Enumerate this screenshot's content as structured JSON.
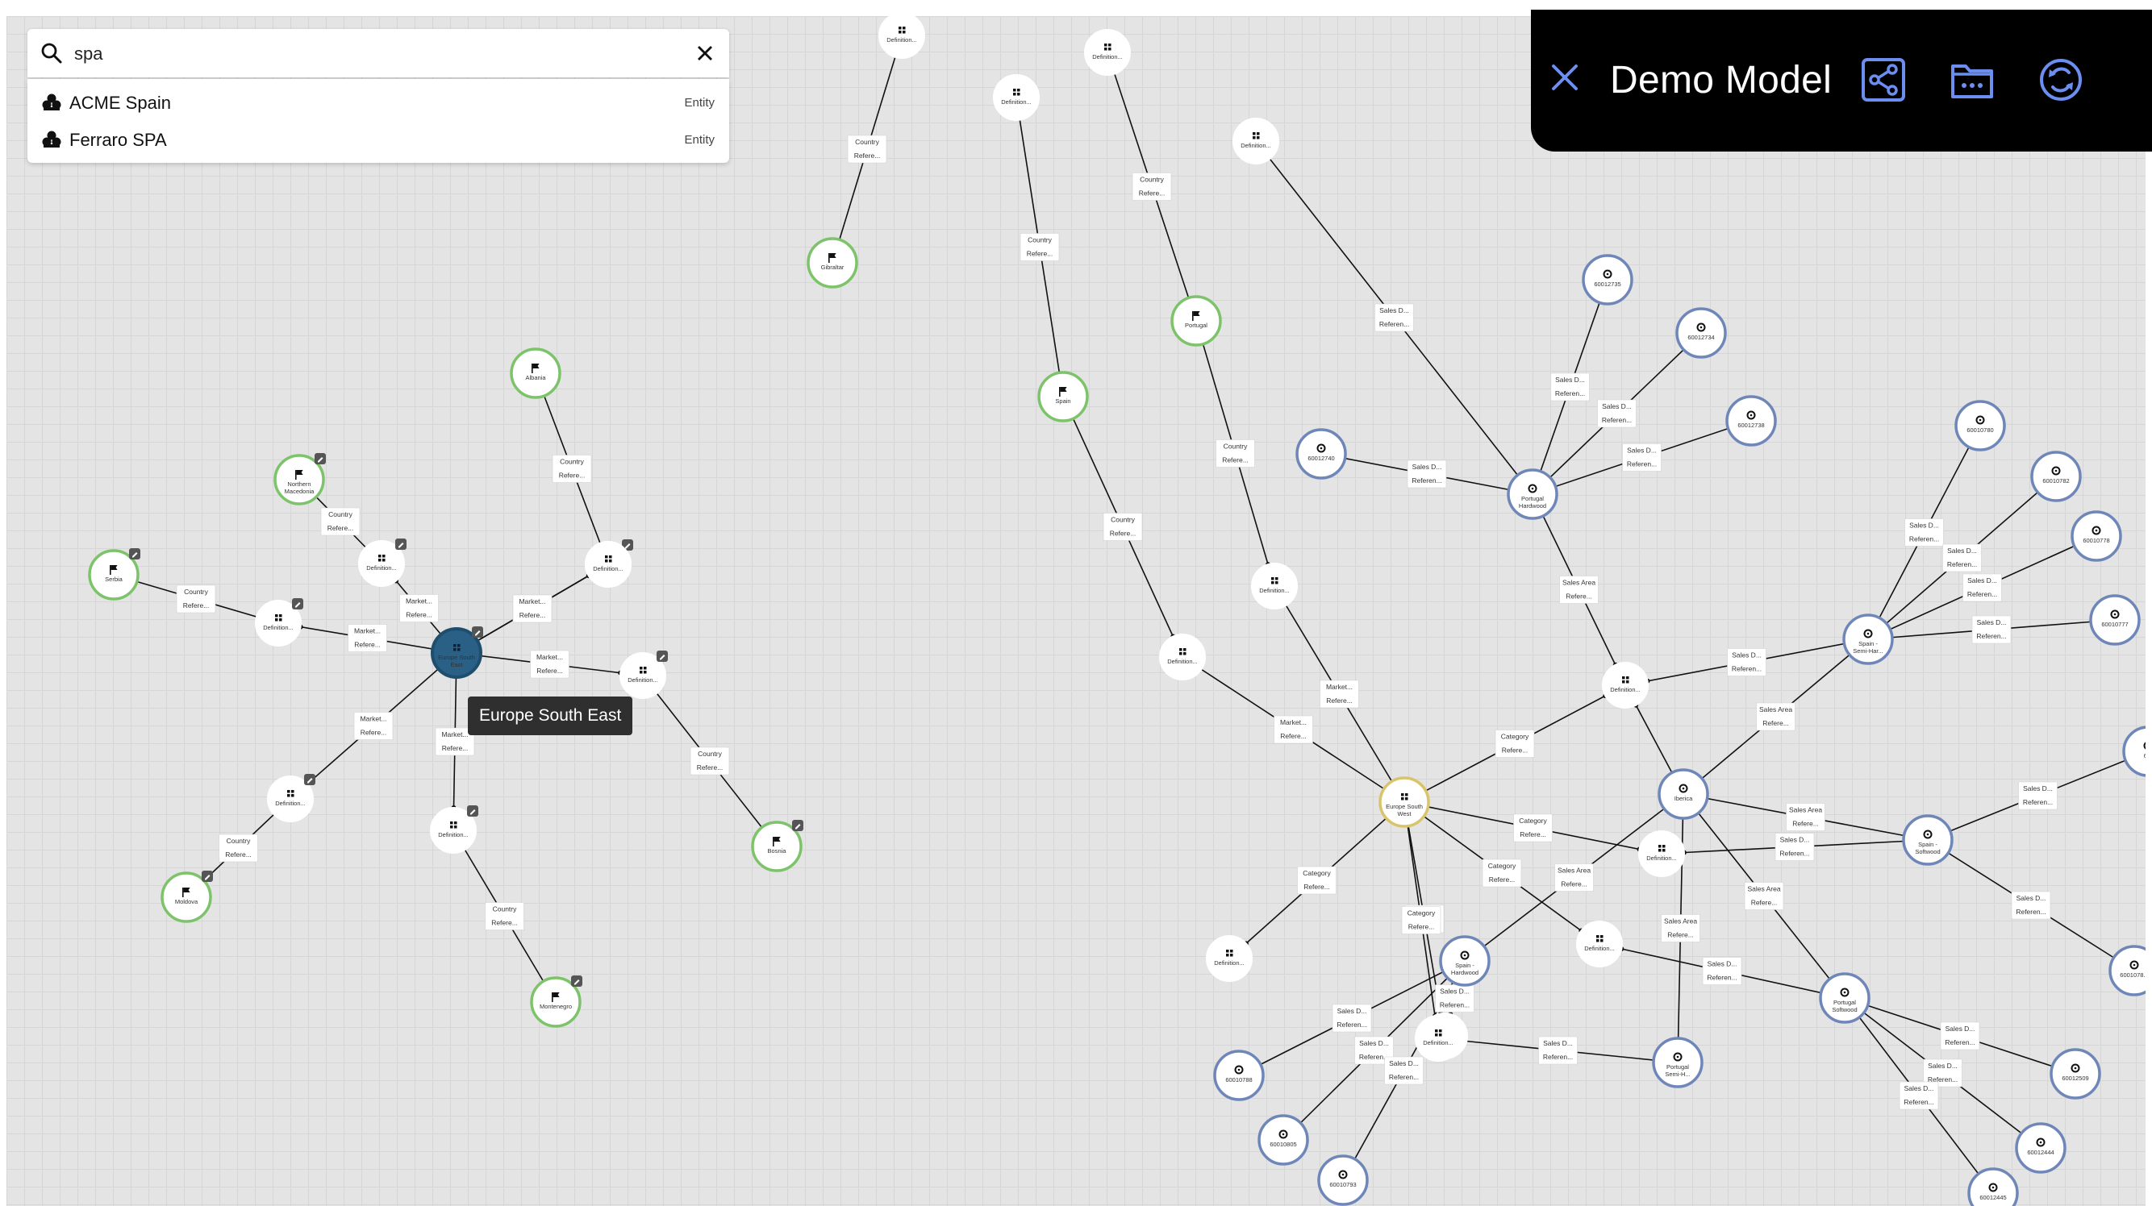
{
  "search": {
    "query": "spa",
    "results": [
      {
        "name": "ACME Spain",
        "type": "Entity"
      },
      {
        "name": "Ferraro SPA",
        "type": "Entity"
      }
    ]
  },
  "header": {
    "title": "Demo Model",
    "buttons": [
      "close-icon",
      "graph-share-icon",
      "folder-icon",
      "sync-icon"
    ]
  },
  "tooltip": "Europe South East",
  "colors": {
    "canvas": "#e4e4e4",
    "country_ring": "#7cc36a",
    "salesarea_ring": "#6f87b8",
    "selected_fill": "#2a5f86",
    "region_ring": "#d8c46a",
    "header_bg": "#000000",
    "header_icon": "#6b8ef0"
  },
  "graph": {
    "nodes": [
      {
        "id": "ese",
        "label": "Europe South East",
        "kind": "selected"
      },
      {
        "id": "esw",
        "label": "Europe South West",
        "kind": "region"
      },
      {
        "id": "albania",
        "label": "Albania",
        "kind": "country"
      },
      {
        "id": "nmac",
        "label": "Northern Macedonia",
        "kind": "country"
      },
      {
        "id": "serbia",
        "label": "Serbia",
        "kind": "country"
      },
      {
        "id": "moldova",
        "label": "Moldova",
        "kind": "country"
      },
      {
        "id": "montenegro",
        "label": "Montenegro",
        "kind": "country"
      },
      {
        "id": "bosnia",
        "label": "Bosnia",
        "kind": "country"
      },
      {
        "id": "gibraltar",
        "label": "Gibraltar",
        "kind": "country"
      },
      {
        "id": "spain",
        "label": "Spain",
        "kind": "country"
      },
      {
        "id": "portugal",
        "label": "Portugal",
        "kind": "country"
      },
      {
        "id": "d1",
        "label": "Definition...",
        "kind": "def"
      },
      {
        "id": "d2",
        "label": "Definition...",
        "kind": "def"
      },
      {
        "id": "d3",
        "label": "Definition...",
        "kind": "def"
      },
      {
        "id": "d4",
        "label": "Definition...",
        "kind": "def"
      },
      {
        "id": "d5",
        "label": "Definition...",
        "kind": "def"
      },
      {
        "id": "d6",
        "label": "Definition...",
        "kind": "def"
      },
      {
        "id": "d7",
        "label": "Definition...",
        "kind": "def"
      },
      {
        "id": "d8",
        "label": "Definition...",
        "kind": "def"
      },
      {
        "id": "d9",
        "label": "Definition...",
        "kind": "def"
      },
      {
        "id": "d10",
        "label": "Definition...",
        "kind": "def"
      },
      {
        "id": "d11",
        "label": "Definition...",
        "kind": "def"
      },
      {
        "id": "d12",
        "label": "Definition...",
        "kind": "def"
      },
      {
        "id": "d13",
        "label": "Definition...",
        "kind": "def"
      },
      {
        "id": "d14",
        "label": "Definition...",
        "kind": "def"
      },
      {
        "id": "d15",
        "label": "Definition...",
        "kind": "def"
      },
      {
        "id": "d16",
        "label": "Definition...",
        "kind": "def"
      },
      {
        "id": "d17",
        "label": "Definition...",
        "kind": "def"
      },
      {
        "id": "d18",
        "label": "Definition...",
        "kind": "def"
      },
      {
        "id": "d19",
        "label": "Definition...",
        "kind": "def"
      },
      {
        "id": "pthard",
        "label": "Portugal Hardwood",
        "kind": "sales"
      },
      {
        "id": "iberica",
        "label": "Iberica",
        "kind": "sales"
      },
      {
        "id": "spsemi",
        "label": "Spain - Semi-Har...",
        "kind": "sales"
      },
      {
        "id": "spsoft",
        "label": "Spain - Softwood",
        "kind": "sales"
      },
      {
        "id": "sphard",
        "label": "Spain - Hardwood",
        "kind": "sales"
      },
      {
        "id": "ptsemi",
        "label": "Portugal Semi-H...",
        "kind": "sales"
      },
      {
        "id": "ptsoft",
        "label": "Portugal Softwood",
        "kind": "sales"
      },
      {
        "id": "s12735",
        "label": "60012735",
        "kind": "sales"
      },
      {
        "id": "s12734",
        "label": "60012734",
        "kind": "sales"
      },
      {
        "id": "s12738",
        "label": "60012738",
        "kind": "sales"
      },
      {
        "id": "s12740",
        "label": "60012740",
        "kind": "sales"
      },
      {
        "id": "s10780",
        "label": "60010780",
        "kind": "sales"
      },
      {
        "id": "s10782",
        "label": "60010782",
        "kind": "sales"
      },
      {
        "id": "s10778",
        "label": "60010778",
        "kind": "sales"
      },
      {
        "id": "s10777",
        "label": "60010777",
        "kind": "sales"
      },
      {
        "id": "s10788",
        "label": "60010788",
        "kind": "sales"
      },
      {
        "id": "s10805",
        "label": "60010805",
        "kind": "sales"
      },
      {
        "id": "s10793",
        "label": "60010793",
        "kind": "sales"
      },
      {
        "id": "s12509",
        "label": "60012509",
        "kind": "sales"
      },
      {
        "id": "s12444",
        "label": "60012444",
        "kind": "sales"
      },
      {
        "id": "s12445",
        "label": "60012445",
        "kind": "sales"
      },
      {
        "id": "s1078x",
        "label": "6001078...",
        "kind": "sales"
      },
      {
        "id": "sEdge1",
        "label": "6...",
        "kind": "sales"
      }
    ],
    "edges": [
      {
        "a": "ese",
        "b": "d1",
        "label": [
          "Market...",
          "Refere..."
        ]
      },
      {
        "a": "ese",
        "b": "d2",
        "label": [
          "Market...",
          "Refere..."
        ]
      },
      {
        "a": "ese",
        "b": "d3",
        "label": [
          "Market...",
          "Refere..."
        ]
      },
      {
        "a": "ese",
        "b": "d4",
        "label": [
          "Market...",
          "Refere..."
        ]
      },
      {
        "a": "ese",
        "b": "d5",
        "label": [
          "Market...",
          "Refere..."
        ]
      },
      {
        "a": "ese",
        "b": "d6",
        "label": [
          "Market...",
          "Refere..."
        ]
      },
      {
        "a": "ese",
        "b": "d7",
        "label": [
          "Market...",
          "Refere..."
        ]
      },
      {
        "a": "d1",
        "b": "serbia",
        "label": [
          "Country",
          "Refere..."
        ]
      },
      {
        "a": "d2",
        "b": "nmac",
        "label": [
          "Country",
          "Refere..."
        ]
      },
      {
        "a": "d3",
        "b": "albania",
        "label": [
          "Country",
          "Refere..."
        ]
      },
      {
        "a": "d4",
        "b": "bosnia",
        "label": [
          "Country",
          "Refere..."
        ]
      },
      {
        "a": "d5",
        "b": "montenegro",
        "label": [
          "Country",
          "Refere..."
        ]
      },
      {
        "a": "d6",
        "b": "moldova",
        "label": [
          "Country",
          "Refere..."
        ]
      },
      {
        "a": "d8",
        "b": "gibraltar",
        "label": [
          "Country",
          "Refere..."
        ]
      },
      {
        "a": "d9",
        "b": "spain",
        "label": [
          "Country",
          "Refere..."
        ]
      },
      {
        "a": "d10",
        "b": "portugal",
        "label": [
          "Country",
          "Refere..."
        ]
      },
      {
        "a": "spain",
        "b": "d12",
        "label": [
          "Country",
          "Refere..."
        ]
      },
      {
        "a": "portugal",
        "b": "d13",
        "label": [
          "Country",
          "Refere..."
        ]
      },
      {
        "a": "d12",
        "b": "esw",
        "label": [
          "Market...",
          "Refere..."
        ]
      },
      {
        "a": "d13",
        "b": "esw",
        "label": [
          "Market...",
          "Refere..."
        ]
      },
      {
        "a": "d11",
        "b": "pthard",
        "label": [
          "Sales D...",
          "Referen..."
        ]
      },
      {
        "a": "esw",
        "b": "d14",
        "label": [
          "Category",
          "Refere..."
        ]
      },
      {
        "a": "esw",
        "b": "d15",
        "label": [
          "Category",
          "Refere..."
        ]
      },
      {
        "a": "esw",
        "b": "d16",
        "label": [
          "Category",
          "Refere..."
        ]
      },
      {
        "a": "esw",
        "b": "d17",
        "label": [
          "Category",
          "Refere..."
        ]
      },
      {
        "a": "esw",
        "b": "d18",
        "label": [
          "Category",
          "Refere..."
        ]
      },
      {
        "a": "esw",
        "b": "d19",
        "label": [
          "Category",
          "Refere..."
        ]
      },
      {
        "a": "pthard",
        "b": "s12735",
        "label": [
          "Sales D...",
          "Referen..."
        ]
      },
      {
        "a": "pthard",
        "b": "s12734",
        "label": [
          "Sales D...",
          "Referen..."
        ]
      },
      {
        "a": "pthard",
        "b": "s12738",
        "label": [
          "Sales D...",
          "Referen..."
        ]
      },
      {
        "a": "pthard",
        "b": "s12740",
        "label": [
          "Sales D...",
          "Referen..."
        ]
      },
      {
        "a": "pthard",
        "b": "d14",
        "label": [
          "Sales Area",
          "Refere..."
        ]
      },
      {
        "a": "iberica",
        "b": "d14",
        "label": [
          "",
          ""
        ]
      },
      {
        "a": "iberica",
        "b": "spsemi",
        "label": [
          "Sales Area",
          "Refere..."
        ]
      },
      {
        "a": "iberica",
        "b": "spsoft",
        "label": [
          "Sales Area",
          "Refere..."
        ]
      },
      {
        "a": "iberica",
        "b": "sphard",
        "label": [
          "Sales Area",
          "Refere..."
        ]
      },
      {
        "a": "iberica",
        "b": "ptsemi",
        "label": [
          "Sales Area",
          "Refere..."
        ]
      },
      {
        "a": "iberica",
        "b": "ptsoft",
        "label": [
          "Sales Area",
          "Refere..."
        ]
      },
      {
        "a": "spsemi",
        "b": "d14",
        "label": [
          "Sales D...",
          "Referen..."
        ]
      },
      {
        "a": "spsemi",
        "b": "s10780",
        "label": [
          "Sales D...",
          "Referen..."
        ]
      },
      {
        "a": "spsemi",
        "b": "s10782",
        "label": [
          "Sales D...",
          "Referen..."
        ]
      },
      {
        "a": "spsemi",
        "b": "s10778",
        "label": [
          "Sales D...",
          "Referen..."
        ]
      },
      {
        "a": "spsemi",
        "b": "s10777",
        "label": [
          "Sales D...",
          "Referen..."
        ]
      },
      {
        "a": "spsoft",
        "b": "d15",
        "label": [
          "Sales D...",
          "Referen..."
        ]
      },
      {
        "a": "spsoft",
        "b": "sEdge1",
        "label": [
          "Sales D...",
          "Referen..."
        ]
      },
      {
        "a": "spsoft",
        "b": "s1078x",
        "label": [
          "Sales D...",
          "Referen..."
        ]
      },
      {
        "a": "sphard",
        "b": "d17",
        "label": [
          "Sales D...",
          "Referen..."
        ]
      },
      {
        "a": "sphard",
        "b": "s10788",
        "label": [
          "Sales D...",
          "Referen..."
        ]
      },
      {
        "a": "sphard",
        "b": "s10805",
        "label": [
          "Sales D...",
          "Referen..."
        ]
      },
      {
        "a": "sphard",
        "b": "s10793",
        "label": [
          "Sales D...",
          "Referen..."
        ]
      },
      {
        "a": "ptsemi",
        "b": "d19",
        "label": [
          "Sales D...",
          "Referen..."
        ]
      },
      {
        "a": "ptsoft",
        "b": "d18",
        "label": [
          "Sales D...",
          "Referen..."
        ]
      },
      {
        "a": "ptsoft",
        "b": "s12509",
        "label": [
          "Sales D...",
          "Referen..."
        ]
      },
      {
        "a": "ptsoft",
        "b": "s12444",
        "label": [
          "Sales D...",
          "Referen..."
        ]
      },
      {
        "a": "ptsoft",
        "b": "s12445",
        "label": [
          "Sales D...",
          "Referen..."
        ]
      }
    ]
  }
}
